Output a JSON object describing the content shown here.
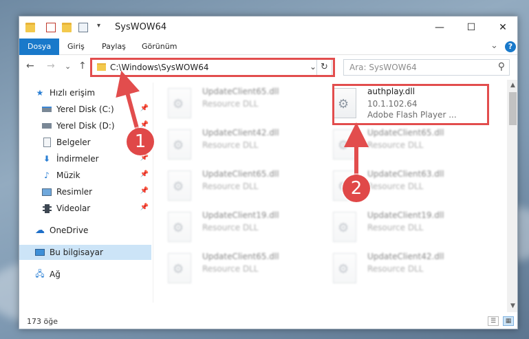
{
  "window": {
    "title": "SysWOW64",
    "qat_dropdown": "▾",
    "controls": {
      "minimize": "—",
      "maximize": "☐",
      "close": "✕"
    }
  },
  "ribbon": {
    "tabs": [
      {
        "label": "Dosya",
        "active": true
      },
      {
        "label": "Giriş"
      },
      {
        "label": "Paylaş"
      },
      {
        "label": "Görünüm"
      }
    ],
    "expand_icon": "⌄",
    "help": "?"
  },
  "navigation": {
    "back": "←",
    "forward": "→",
    "recent": "⌄",
    "up": "↑",
    "address": "C:\\Windows\\SysWOW64",
    "address_dropdown": "⌄",
    "refresh": "↻",
    "search_placeholder": "Ara: SysWOW64",
    "search_icon": "⚲"
  },
  "sidebar": {
    "quick_access": "Hızlı erişim",
    "items": [
      {
        "label": "Yerel Disk (C:)",
        "icon": "drive-icon",
        "pinned": true
      },
      {
        "label": "Yerel Disk (D:)",
        "icon": "drive-icon",
        "pinned": true
      },
      {
        "label": "Belgeler",
        "icon": "documents-icon",
        "pinned": true
      },
      {
        "label": "İndirmeler",
        "icon": "downloads-icon",
        "pinned": true
      },
      {
        "label": "Müzik",
        "icon": "music-icon",
        "pinned": true
      },
      {
        "label": "Resimler",
        "icon": "pictures-icon",
        "pinned": true
      },
      {
        "label": "Videolar",
        "icon": "videos-icon",
        "pinned": true
      }
    ],
    "onedrive": "OneDrive",
    "this_pc": "Bu bilgisayar",
    "network": "Ağ"
  },
  "files": [
    {
      "name": "UpdateClient65.dll",
      "type": "Resource DLL",
      "highlighted": false
    },
    {
      "name": "authplay.dll",
      "type": "10.1.102.64",
      "description": "Adobe Flash Player ...",
      "highlighted": true
    },
    {
      "name": "UpdateClient42.dll",
      "type": "Resource DLL",
      "highlighted": false
    },
    {
      "name": "UpdateClient65.dll",
      "type": "Resource DLL",
      "highlighted": false
    },
    {
      "name": "UpdateClient65.dll",
      "type": "Resource DLL",
      "highlighted": false
    },
    {
      "name": "UpdateClient63.dll",
      "type": "Resource DLL",
      "highlighted": false
    },
    {
      "name": "UpdateClient19.dll",
      "type": "Resource DLL",
      "highlighted": false
    },
    {
      "name": "UpdateClient19.dll",
      "type": "Resource DLL",
      "highlighted": false
    },
    {
      "name": "UpdateClient65.dll",
      "type": "Resource DLL",
      "highlighted": false
    },
    {
      "name": "UpdateClient42.dll",
      "type": "Resource DLL",
      "highlighted": false
    }
  ],
  "status": {
    "item_count": "173 öğe"
  },
  "annotations": {
    "step1": "1",
    "step2": "2",
    "accent_color": "#e24d4d"
  },
  "scrollbar": {
    "up": "▲",
    "down": "▼"
  },
  "view_buttons": {
    "details": "☰",
    "tiles": "▦"
  }
}
